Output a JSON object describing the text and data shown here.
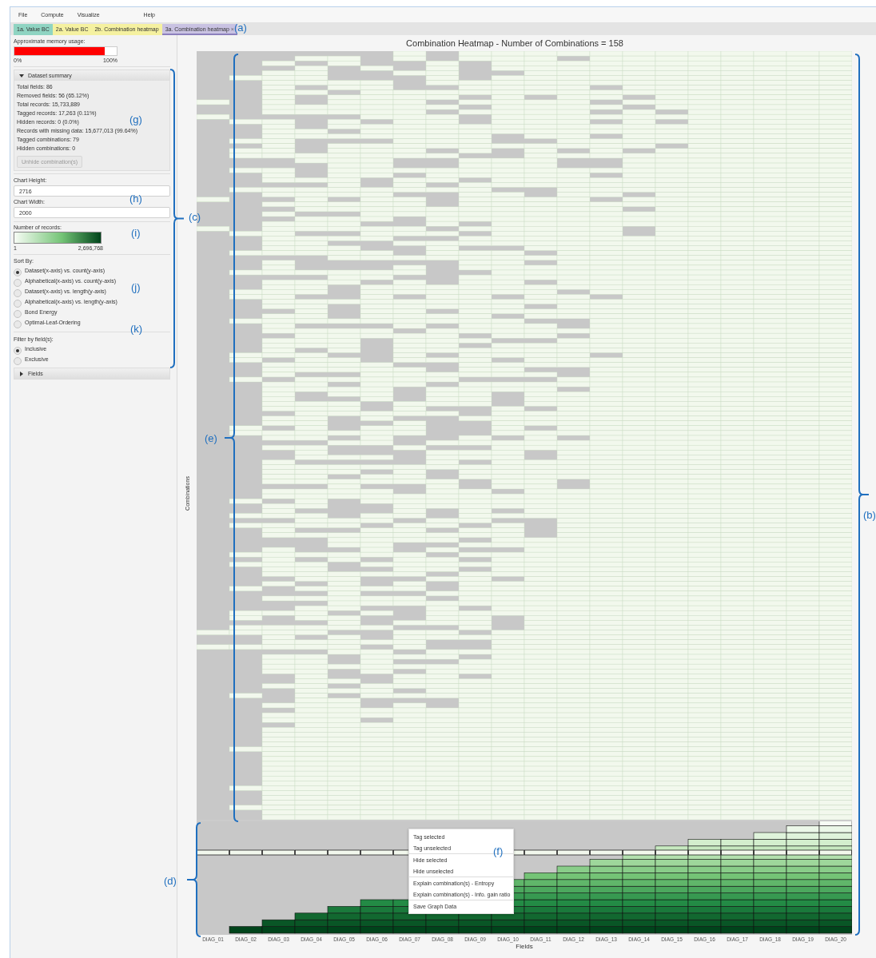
{
  "menu": [
    "File",
    "Compute",
    "Visualize",
    "Help"
  ],
  "tabs": [
    {
      "label": "1a. Value BC",
      "color": "#8fd4c2",
      "selected": false
    },
    {
      "label": "2a. Value BC",
      "color": "#f5f1a0",
      "selected": false
    },
    {
      "label": "2b. Combination heatmap",
      "color": "#f5f1a0",
      "selected": false
    },
    {
      "label": "3a. Combination heatmap",
      "color": "#c9c2e2",
      "selected": true,
      "close": "×"
    }
  ],
  "memory": {
    "label": "Approximate memory usage:",
    "level": 0.88,
    "min": "0%",
    "max": "100%"
  },
  "summary": {
    "title": "Dataset summary",
    "expanded": true,
    "lines": [
      "Total fields: 86",
      "Removed fields: 56 (65.12%)",
      "Total records: 15,733,889",
      "Tagged records: 17,263 (0.11%)",
      "Hidden records: 0 (0.0%)",
      "Records with missing data: 15,677,013 (99.64%)",
      "Tagged combinations: 79",
      "Hidden combinations: 0"
    ],
    "button": {
      "label": "Unhide combination(s)",
      "disabled": true
    }
  },
  "chart_height": {
    "label": "Chart Height:",
    "value": "2716"
  },
  "chart_width": {
    "label": "Chart Width:",
    "value": "2000"
  },
  "legend": {
    "label": "Number of records:",
    "min": "1",
    "max": "2,696,768"
  },
  "sort": {
    "label": "Sort By:",
    "options": [
      {
        "label": "Dataset(x-axis) vs. count(y-axis)",
        "selected": true
      },
      {
        "label": "Alphabetical(x-axis) vs. count(y-axis)",
        "selected": false
      },
      {
        "label": "Dataset(x-axis) vs. length(y-axis)",
        "selected": false
      },
      {
        "label": "Alphabetical(x-axis) vs. length(y-axis)",
        "selected": false
      },
      {
        "label": "Bond Energy",
        "selected": false
      },
      {
        "label": "Optimal-Leaf-Ordering",
        "selected": false
      }
    ]
  },
  "filter": {
    "label": "Filter by field(s):",
    "options": [
      {
        "label": "Inclusive",
        "selected": true
      },
      {
        "label": "Exclusive",
        "selected": false
      }
    ]
  },
  "fields_section": {
    "title": "Fields",
    "expanded": false
  },
  "chart": {
    "title": "Combination Heatmap - Number of Combinations = 158",
    "ylabel": "Combinations",
    "xlabel": "Fields",
    "fields": [
      "DIAG_01",
      "DIAG_02",
      "DIAG_03",
      "DIAG_04",
      "DIAG_05",
      "DIAG_06",
      "DIAG_07",
      "DIAG_08",
      "DIAG_09",
      "DIAG_10",
      "DIAG_11",
      "DIAG_12",
      "DIAG_13",
      "DIAG_14",
      "DIAG_15",
      "DIAG_16",
      "DIAG_17",
      "DIAG_18",
      "DIAG_19",
      "DIAG_20"
    ]
  },
  "context_menu": {
    "groups": [
      [
        "Tag selected",
        "Tag unselected"
      ],
      [
        "Hide selected",
        "Hide unselected"
      ],
      [
        "Explain combination(s) - Entropy",
        "Explain combination(s) - Info. gain ratio"
      ],
      [
        "Save Graph Data"
      ]
    ]
  },
  "annotations": {
    "a": "(a)",
    "b": "(b)",
    "c": "(c)",
    "d": "(d)",
    "e": "(e)",
    "f": "(f)",
    "g": "(g)",
    "h": "(h)",
    "i": "(i)",
    "j": "(j)",
    "k": "(k)"
  }
}
